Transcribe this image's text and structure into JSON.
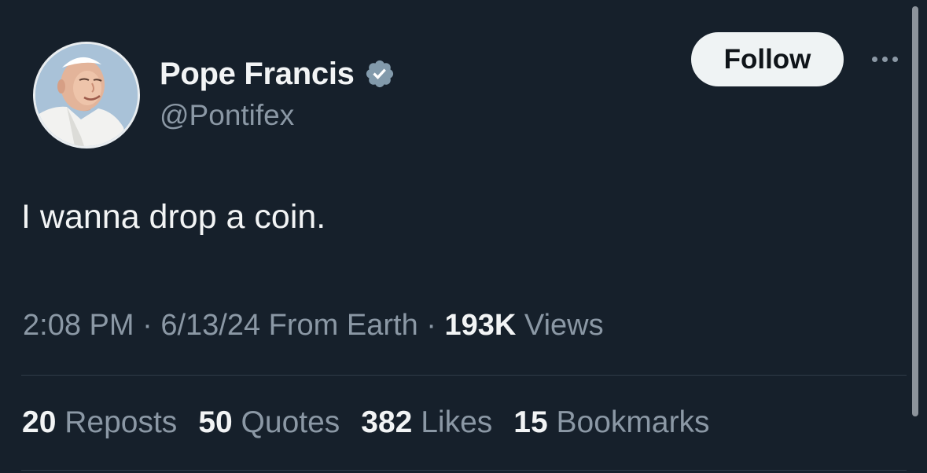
{
  "author": {
    "display_name": "Pope Francis",
    "handle": "@Pontifex",
    "verified": true,
    "avatar_icon": "pope-avatar"
  },
  "actions": {
    "follow_label": "Follow",
    "more_icon": "more-dots-icon"
  },
  "tweet": {
    "text": "I wanna drop a coin."
  },
  "meta": {
    "time": "2:08 PM",
    "sep1": " · ",
    "date": "6/13/24",
    "source": "From Earth",
    "sep2": " · ",
    "views_count": "193K",
    "views_label": "Views"
  },
  "stats": [
    {
      "count": "20",
      "label": "Reposts"
    },
    {
      "count": "50",
      "label": "Quotes"
    },
    {
      "count": "382",
      "label": "Likes"
    },
    {
      "count": "15",
      "label": "Bookmarks"
    }
  ],
  "colors": {
    "background": "#16202b",
    "verified_badge": "#829aab",
    "muted_text": "#8b98a5"
  }
}
